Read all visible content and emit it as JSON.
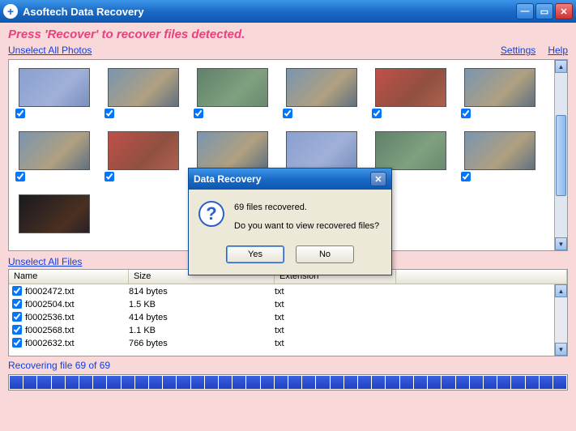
{
  "titlebar": {
    "title": "Asoftech Data Recovery"
  },
  "instruction": "Press 'Recover' to recover files detected.",
  "links": {
    "unselect_photos": "Unselect All Photos",
    "unselect_files": "Unselect All Files",
    "settings": "Settings",
    "help": "Help"
  },
  "files": {
    "headers": {
      "name": "Name",
      "size": "Size",
      "ext": "Extension"
    },
    "rows": [
      {
        "name": "f0002472.txt",
        "size": "814 bytes",
        "ext": "txt"
      },
      {
        "name": "f0002504.txt",
        "size": "1.5 KB",
        "ext": "txt"
      },
      {
        "name": "f0002536.txt",
        "size": "414 bytes",
        "ext": "txt"
      },
      {
        "name": "f0002568.txt",
        "size": "1.1 KB",
        "ext": "txt"
      },
      {
        "name": "f0002632.txt",
        "size": "766 bytes",
        "ext": "txt"
      }
    ]
  },
  "progress": {
    "label": "Recovering file 69 of 69"
  },
  "modal": {
    "title": "Data Recovery",
    "line1": "69 files recovered.",
    "line2": "Do you want to view recovered files?",
    "yes": "Yes",
    "no": "No"
  }
}
